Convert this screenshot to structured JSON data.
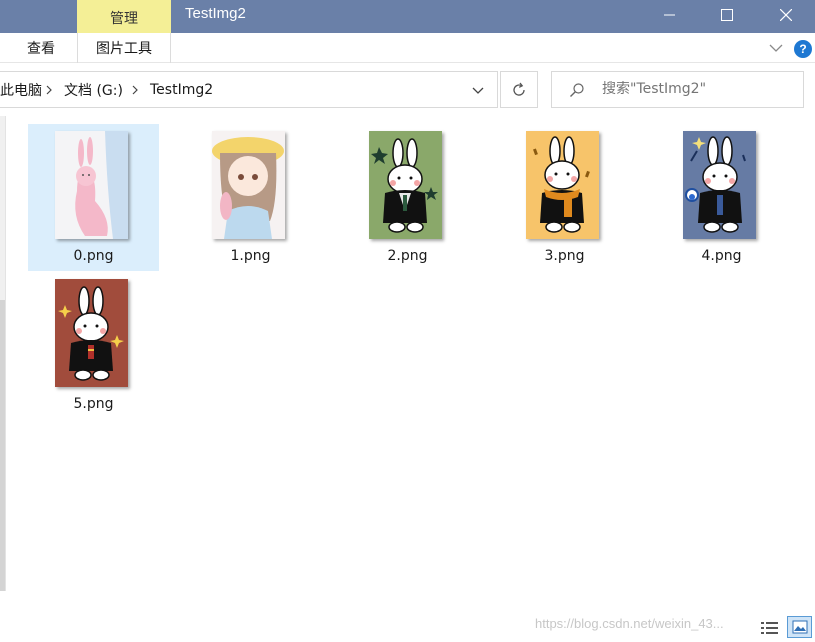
{
  "window": {
    "title": "TestImg2",
    "context_tab": "管理",
    "controls": {
      "minimize": "minimize",
      "maximize": "maximize",
      "close": "close"
    }
  },
  "ribbon": {
    "tabs": [
      {
        "label": "查看"
      },
      {
        "label": "图片工具"
      }
    ]
  },
  "address": {
    "crumbs": [
      "此电脑",
      "文档 (G:)",
      "TestImg2"
    ],
    "separator_icon": "chevron-right-icon"
  },
  "search": {
    "placeholder": "搜索\"TestImg2\""
  },
  "files": [
    {
      "name": "0.png",
      "selected": true,
      "thumb_bg": "#f4f4f6"
    },
    {
      "name": "1.png",
      "selected": false,
      "thumb_bg": "#f6f2f2"
    },
    {
      "name": "2.png",
      "selected": false,
      "thumb_bg": "#8aa86a"
    },
    {
      "name": "3.png",
      "selected": false,
      "thumb_bg": "#f7c46a"
    },
    {
      "name": "4.png",
      "selected": false,
      "thumb_bg": "#667ba4"
    },
    {
      "name": "5.png",
      "selected": false,
      "thumb_bg": "#a14c3c"
    }
  ],
  "watermark": "https://blog.csdn.net/weixin_43...",
  "colors": {
    "titlebar": "#6a80a8",
    "context_tab": "#f4ef96",
    "selection": "#dbeefc",
    "help": "#1e78d2"
  }
}
